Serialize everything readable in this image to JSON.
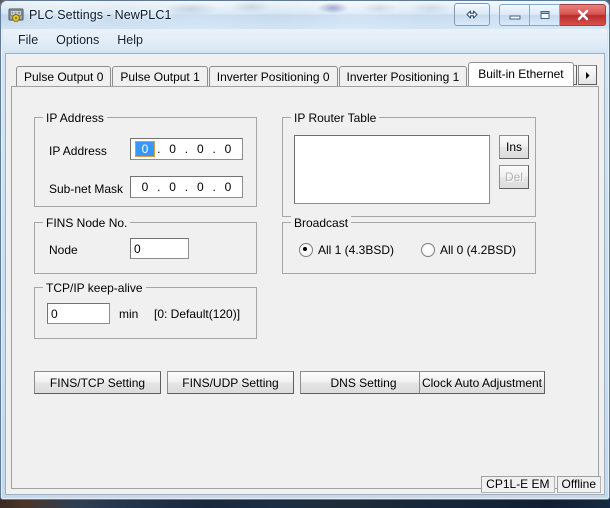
{
  "window": {
    "title": "PLC Settings - NewPLC1",
    "icon": "plc-settings-icon",
    "caption_buttons": {
      "toggle": "resize-toggle-icon",
      "minimize": "minimize-icon",
      "maximize": "maximize-icon",
      "close": "close-icon"
    }
  },
  "menubar": {
    "items": [
      {
        "label": "File"
      },
      {
        "label": "Options"
      },
      {
        "label": "Help"
      }
    ]
  },
  "tabs": {
    "items": [
      {
        "label": "Pulse Output 0",
        "active": false
      },
      {
        "label": "Pulse Output 1",
        "active": false
      },
      {
        "label": "Inverter Positioning 0",
        "active": false
      },
      {
        "label": "Inverter Positioning 1",
        "active": false
      },
      {
        "label": "Built-in Ethernet",
        "active": true
      }
    ],
    "scroll_left": "scroll-left-icon",
    "scroll_right": "scroll-right-icon"
  },
  "ip_address_group": {
    "legend": "IP Address",
    "ip_address": {
      "label": "IP Address",
      "octets": [
        "0",
        "0",
        "0",
        "0"
      ],
      "selected_octet": 0,
      "separator": "."
    },
    "subnet_mask": {
      "label": "Sub-net Mask",
      "octets": [
        "0",
        "0",
        "0",
        "0"
      ],
      "separator": "."
    }
  },
  "ip_router_table_group": {
    "legend": "IP Router Table",
    "entries": [],
    "buttons": [
      {
        "label": "Ins",
        "disabled": false
      },
      {
        "label": "Del",
        "disabled": true
      }
    ]
  },
  "fins_node_group": {
    "legend": "FINS Node No.",
    "node_label": "Node",
    "node_value": "0"
  },
  "broadcast_group": {
    "legend": "Broadcast",
    "options": [
      {
        "label": "All 1 (4.3BSD)",
        "checked": true
      },
      {
        "label": "All 0 (4.2BSD)",
        "checked": false
      }
    ]
  },
  "keepalive_group": {
    "legend": "TCP/IP keep-alive",
    "value": "0",
    "unit": "min",
    "hint": "[0: Default(120)]"
  },
  "action_buttons": [
    {
      "label": "FINS/TCP Setting"
    },
    {
      "label": "FINS/UDP Setting"
    },
    {
      "label": "DNS Setting"
    },
    {
      "label": "Clock Auto Adjustment"
    }
  ],
  "statusbar": {
    "panes": [
      {
        "label": "CP1L-E EM"
      },
      {
        "label": "Offline"
      }
    ]
  },
  "colors": {
    "selection_blue": "#3399ff",
    "close_red": "#c9302c",
    "client_bg": "#f0f0f0"
  }
}
